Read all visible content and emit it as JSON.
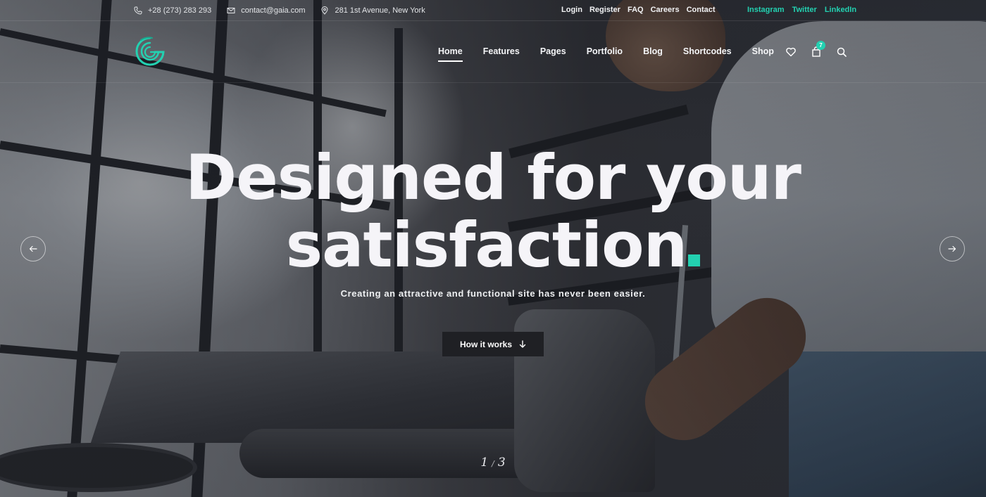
{
  "topbar": {
    "phone": "+28 (273) 283 293",
    "email": "contact@gaia.com",
    "address": "281 1st Avenue, New York",
    "links": [
      "Login",
      "Register",
      "FAQ",
      "Careers",
      "Contact"
    ],
    "social": [
      "Instagram",
      "Twitter",
      "LinkedIn"
    ]
  },
  "header": {
    "nav": [
      "Home",
      "Features",
      "Pages",
      "Portfolio",
      "Blog",
      "Shortcodes",
      "Shop"
    ],
    "active_nav": "Home",
    "cart_count": "7",
    "icons": [
      "heart-icon",
      "shopping-bag-icon",
      "search-icon"
    ]
  },
  "hero": {
    "title_line1": "Designed for your",
    "title_line2": "satisfaction",
    "subtitle": "Creating an attractive and functional site has never been easier.",
    "cta_label": "How it works"
  },
  "slider": {
    "current": "1",
    "total": "3"
  },
  "colors": {
    "accent": "#23d1b1",
    "button_bg": "#1f2024",
    "title_text": "#f5f4f8"
  }
}
